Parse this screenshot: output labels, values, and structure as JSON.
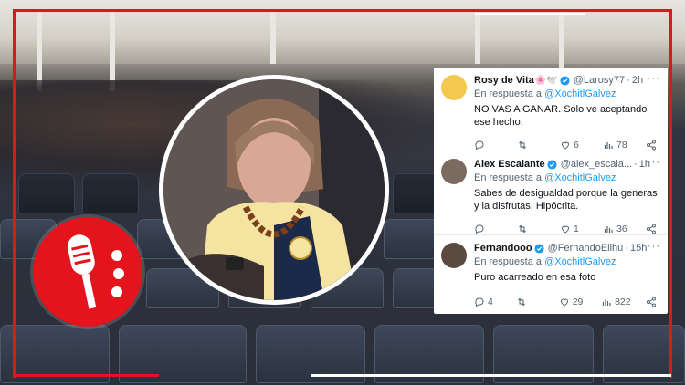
{
  "tweets": [
    {
      "name": "Rosy de Vita",
      "badge": "🌸🕊️",
      "handle": "@Larosy77",
      "time": "2h",
      "reply_prefix": "En respuesta a",
      "reply_to": "@XochitlGalvez",
      "text": "NO VAS A GANAR. Solo ve aceptando ese hecho.",
      "replies": "",
      "retweets": "",
      "likes": "6",
      "views": "78",
      "avatar_color": "#f2c94c"
    },
    {
      "name": "Alex Escalante",
      "badge": "",
      "handle": "@alex_escala...",
      "time": "1h",
      "reply_prefix": "En respuesta a",
      "reply_to": "@XochitlGalvez",
      "text": "Sabes de desigualdad porque la generas y la disfrutas. Hipócrita.",
      "replies": "",
      "retweets": "",
      "likes": "1",
      "views": "36",
      "avatar_color": "#7a6a5f"
    },
    {
      "name": "Fernandooo",
      "badge": "",
      "handle": "@FernandoElihu",
      "time": "15h",
      "reply_prefix": "En respuesta a",
      "reply_to": "@XochitlGalvez",
      "text": "Puro acarreado en esa foto",
      "replies": "4",
      "retweets": "",
      "likes": "29",
      "views": "822",
      "avatar_color": "#5a4a3f"
    }
  ],
  "more_label": "···",
  "dot": "·",
  "colors": {
    "accent_red": "#e3141b",
    "twitter_blue": "#1d9bf0",
    "jersey_yellow": "#f4e3a1",
    "jersey_navy": "#1b2a4a"
  },
  "icons": [
    "microphone-logo-icon",
    "verified-badge-icon",
    "reply-icon",
    "retweet-icon",
    "like-icon",
    "views-icon",
    "share-icon"
  ]
}
